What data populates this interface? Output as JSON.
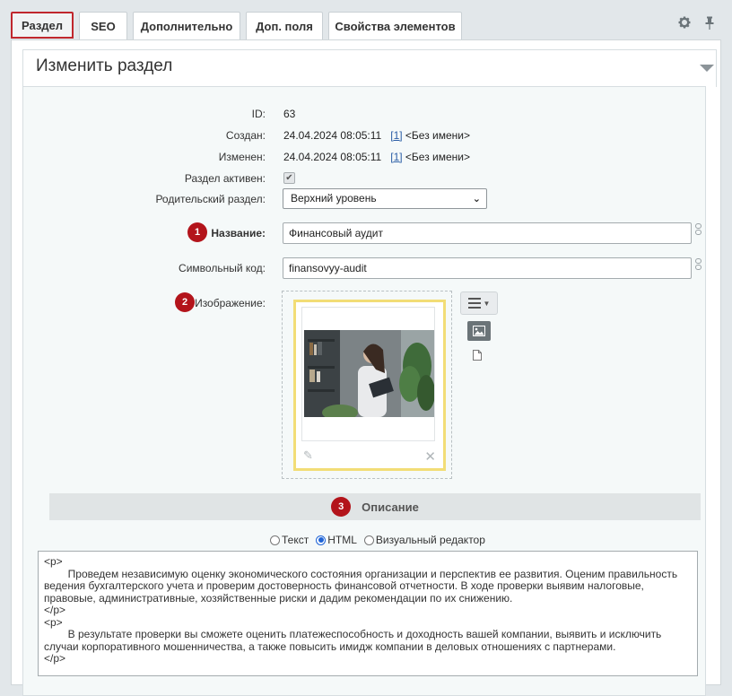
{
  "tabs": [
    {
      "label": "Раздел",
      "active": true
    },
    {
      "label": "SEO",
      "active": false
    },
    {
      "label": "Дополнительно",
      "active": false
    },
    {
      "label": "Доп. поля",
      "active": false
    },
    {
      "label": "Свойства элементов",
      "active": false
    }
  ],
  "tab_icons": [
    "gear-icon",
    "pin-icon"
  ],
  "panel": {
    "title": "Изменить раздел"
  },
  "fields": {
    "id": {
      "label": "ID:",
      "value": "63"
    },
    "created": {
      "label": "Создан:",
      "date": "24.04.2024 08:05:11",
      "user_link": "[1]",
      "user_name": "<Без имени>"
    },
    "modified": {
      "label": "Изменен:",
      "date": "24.04.2024 08:05:11",
      "user_link": "[1]",
      "user_name": "<Без имени>"
    },
    "active": {
      "label": "Раздел активен:",
      "checked": true
    },
    "parent": {
      "label": "Родительский раздел:",
      "value": "Верхний уровень"
    },
    "name": {
      "label": "Название:",
      "value": "Финансовый аудит"
    },
    "code": {
      "label": "Символьный код:",
      "value": "finansovyy-audit"
    },
    "image": {
      "label": "Изображение:"
    }
  },
  "badges": {
    "name": "1",
    "image": "2",
    "description": "3"
  },
  "description": {
    "section_title": "Описание",
    "modes": {
      "text": "Текст",
      "html": "HTML",
      "visual": "Визуальный редактор",
      "selected": "HTML"
    },
    "content": "<p>\n        Проведем независимую оценку экономического состояния организации и перспектив ее развития. Оценим правильность ведения бухгалтерского учета и проверим достоверность финансовой отчетности. В ходе проверки выявим налоговые, правовые, административные, хозяйственные риски и дадим рекомендации по их снижению.\n</p>\n<p>\n        В результате проверки вы сможете оценить платежеспособность и доходность вашей компании, выявить и исключить случаи корпоративного мошенничества, а также повысить имидж компании в деловых отношениях с партнерами.\n</p>"
  },
  "colors": {
    "accent_red": "#b3141b",
    "image_border": "#f2dd76",
    "link": "#2b5ea6",
    "radio": "#1f64d6"
  }
}
